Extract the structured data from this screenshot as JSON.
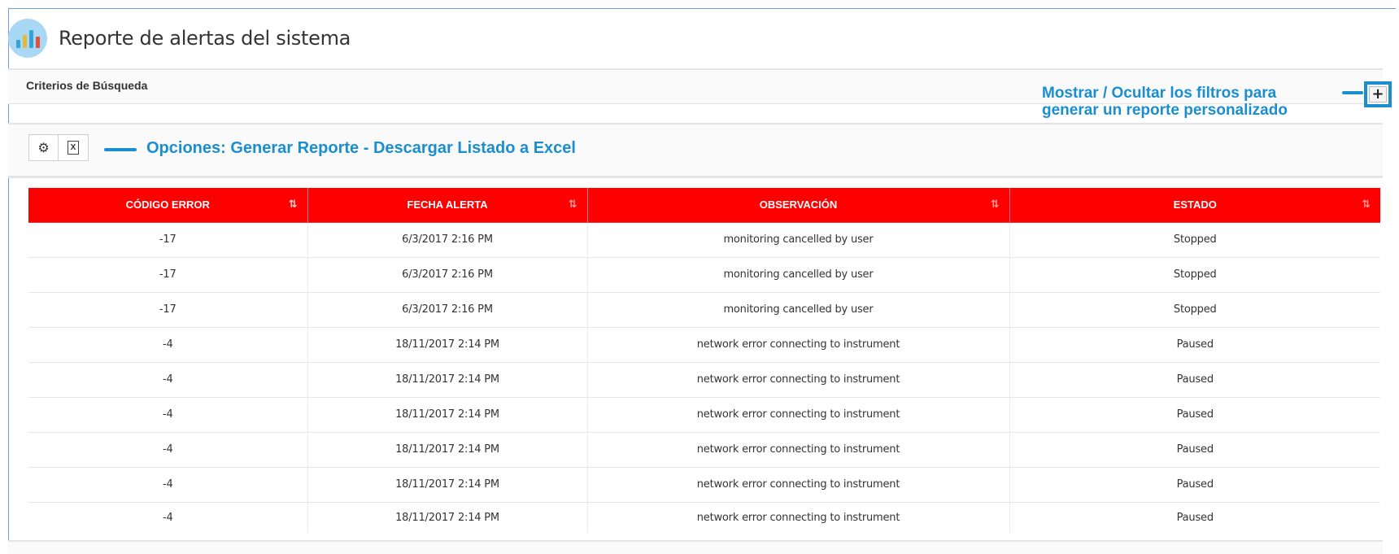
{
  "header": {
    "title": "Reporte de alertas del sistema",
    "icon": "bar-chart-icon"
  },
  "criteria": {
    "label": "Criterios de Búsqueda",
    "toggle_symbol": "+"
  },
  "annotations": {
    "filters": [
      "Mostrar / Ocultar los filtros para",
      "generar un reporte personalizado"
    ],
    "options": "Opciones: Generar Reporte - Descargar Listado a Excel",
    "color": "#1a8ecf"
  },
  "options": {
    "settings_icon": "⚙",
    "excel_icon": "X"
  },
  "table": {
    "header_color": "#ff0000",
    "columns": [
      "CÓDIGO ERROR",
      "FECHA ALERTA",
      "OBSERVACIÓN",
      "ESTADO"
    ],
    "rows": [
      [
        "-17",
        "6/3/2017 2:16 PM",
        "monitoring cancelled by user",
        "Stopped"
      ],
      [
        "-17",
        "6/3/2017 2:16 PM",
        "monitoring cancelled by user",
        "Stopped"
      ],
      [
        "-17",
        "6/3/2017 2:16 PM",
        "monitoring cancelled by user",
        "Stopped"
      ],
      [
        "-4",
        "18/11/2017 2:14 PM",
        "network error connecting to instrument",
        "Paused"
      ],
      [
        "-4",
        "18/11/2017 2:14 PM",
        "network error connecting to instrument",
        "Paused"
      ],
      [
        "-4",
        "18/11/2017 2:14 PM",
        "network error connecting to instrument",
        "Paused"
      ],
      [
        "-4",
        "18/11/2017 2:14 PM",
        "network error connecting to instrument",
        "Paused"
      ],
      [
        "-4",
        "18/11/2017 2:14 PM",
        "network error connecting to instrument",
        "Paused"
      ],
      [
        "-4",
        "18/11/2017 2:14 PM",
        "network error connecting to instrument",
        "Paused"
      ]
    ]
  }
}
